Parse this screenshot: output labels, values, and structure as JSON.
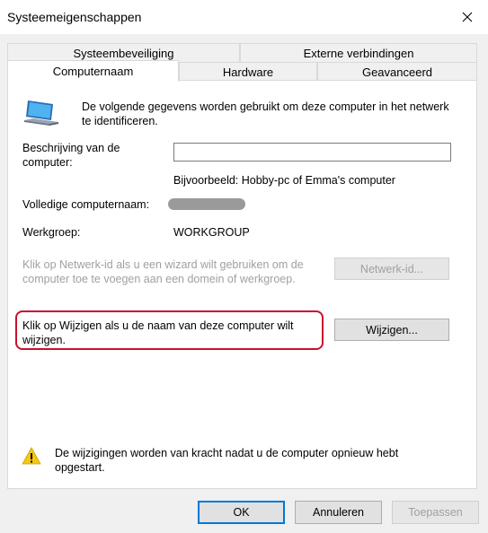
{
  "window": {
    "title": "Systeemeigenschappen",
    "close_icon": "close-icon"
  },
  "tabs": {
    "row_top": [
      {
        "label": "Systeembeveiliging"
      },
      {
        "label": "Externe verbindingen"
      }
    ],
    "row_bottom": [
      {
        "label": "Computernaam",
        "active": true
      },
      {
        "label": "Hardware"
      },
      {
        "label": "Geavanceerd"
      }
    ]
  },
  "panel": {
    "intro": "De volgende gegevens worden gebruikt om deze computer in het netwerk te identificeren.",
    "description_label": "Beschrijving van de computer:",
    "description_value": "",
    "example_text": "Bijvoorbeeld: Hobby-pc of Emma's computer",
    "fullname_label": "Volledige computernaam:",
    "workgroup_label": "Werkgroep:",
    "workgroup_value": "WORKGROUP",
    "netid_text": "Klik op Netwerk-id als u een wizard wilt gebruiken om de computer toe te voegen aan een domein of werkgroep.",
    "netid_button": "Netwerk-id...",
    "change_text": "Klik op Wijzigen als u de naam van deze computer wilt wijzigen.",
    "change_button": "Wijzigen...",
    "warning_text": "De wijzigingen worden van kracht nadat u de computer opnieuw hebt opgestart."
  },
  "footer": {
    "ok": "OK",
    "cancel": "Annuleren",
    "apply": "Toepassen"
  },
  "colors": {
    "highlight": "#c8102e",
    "accent": "#0078d7",
    "warning": "#f2c811"
  }
}
